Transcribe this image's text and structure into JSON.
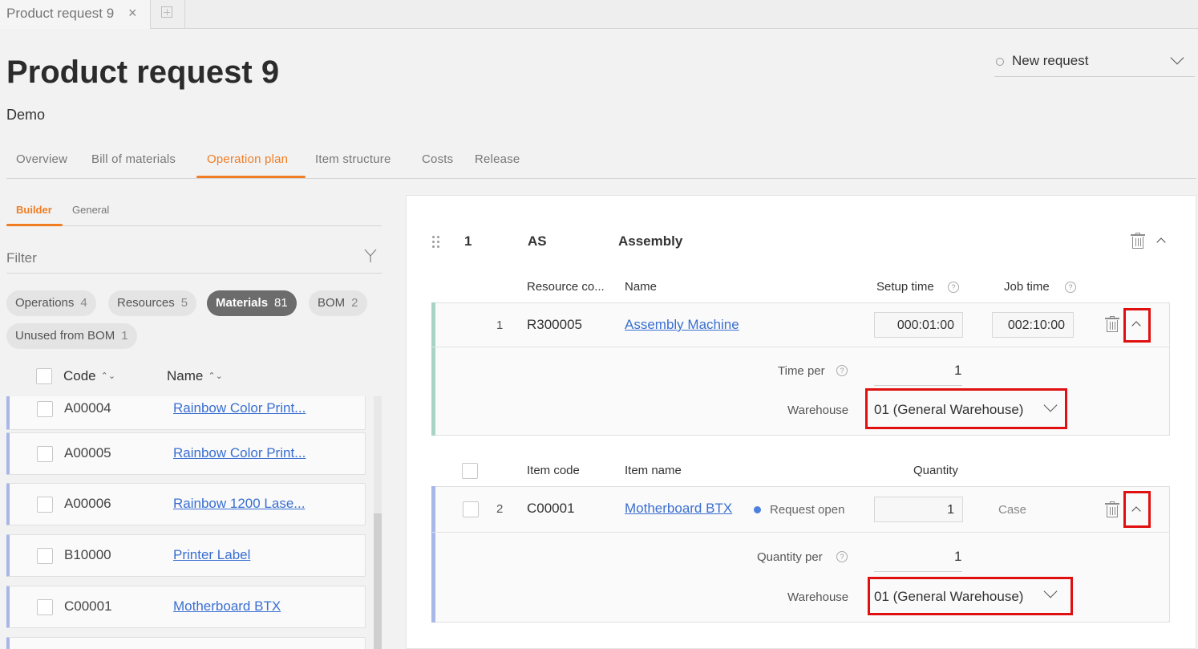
{
  "browser_tab": {
    "title": "Product request 9",
    "close": "×"
  },
  "header": {
    "title": "Product request 9",
    "subtitle": "Demo",
    "status": "New request"
  },
  "main_tabs": [
    "Overview",
    "Bill of materials",
    "Operation plan",
    "Item structure",
    "Costs",
    "Release"
  ],
  "sub_tabs": [
    "Builder",
    "General"
  ],
  "filter": {
    "placeholder": "Filter"
  },
  "chips": [
    {
      "label": "Operations",
      "count": "4"
    },
    {
      "label": "Resources",
      "count": "5"
    },
    {
      "label": "Materials",
      "count": "81"
    },
    {
      "label": "BOM",
      "count": "2"
    },
    {
      "label": "Unused from BOM",
      "count": "1"
    }
  ],
  "list": {
    "headers": {
      "code": "Code",
      "name": "Name"
    },
    "rows": [
      {
        "code": "A00004",
        "name": "Rainbow Color Print..."
      },
      {
        "code": "A00005",
        "name": "Rainbow Color Print..."
      },
      {
        "code": "A00006",
        "name": "Rainbow 1200 Lase..."
      },
      {
        "code": "B10000",
        "name": "Printer Label"
      },
      {
        "code": "C00001",
        "name": "Motherboard BTX"
      }
    ]
  },
  "operation": {
    "num": "1",
    "code": "AS",
    "name": "Assembly",
    "resource_headers": {
      "code": "Resource co...",
      "name": "Name",
      "setup": "Setup time",
      "job": "Job time"
    },
    "resource": {
      "num": "1",
      "code": "R300005",
      "name": "Assembly Machine",
      "setup_time": "000:01:00",
      "job_time": "002:10:00",
      "time_per_label": "Time per",
      "time_per_value": "1",
      "warehouse_label": "Warehouse",
      "warehouse_value": "01 (General Warehouse)"
    },
    "item_headers": {
      "code": "Item code",
      "name": "Item name",
      "quantity": "Quantity"
    },
    "item": {
      "num": "2",
      "code": "C00001",
      "name": "Motherboard BTX",
      "status": "Request open",
      "quantity": "1",
      "unit": "Case",
      "quantity_per_label": "Quantity per",
      "quantity_per_value": "1",
      "warehouse_label": "Warehouse",
      "warehouse_value": "01 (General Warehouse)"
    }
  },
  "colors": {
    "accent": "#f07d24",
    "link": "#3a6fd1",
    "highlight": "#e01010",
    "resource_bar": "#a8d4c4",
    "item_bar": "#a6b7e8"
  }
}
